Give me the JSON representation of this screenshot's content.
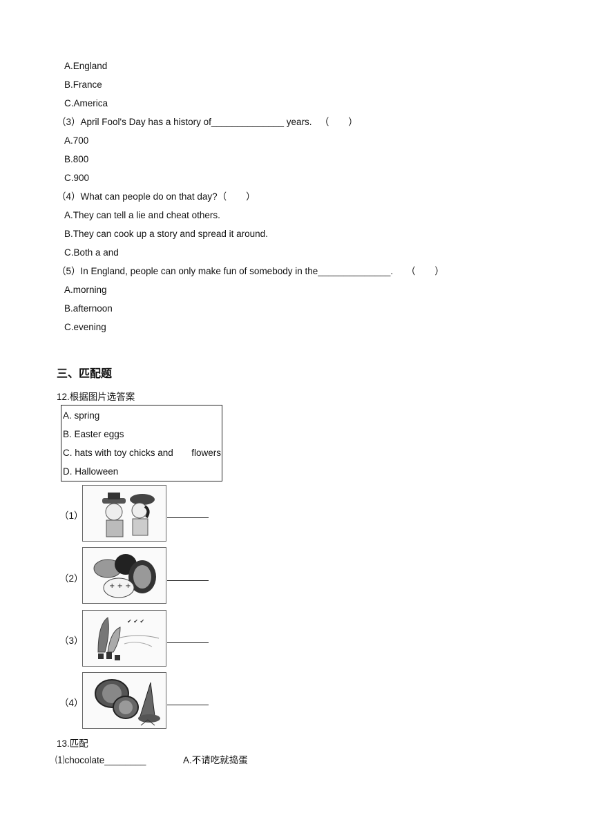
{
  "q2_options": [
    "A.England",
    "B.France",
    "C.America"
  ],
  "q3": {
    "number": "（3）",
    "text_before": "April Fool's Day has a history of",
    "blank": "______________",
    "text_after": " years.",
    "paren_open": "（",
    "paren_close": "）",
    "options": [
      "A.700",
      "B.800",
      "C.900"
    ]
  },
  "q4": {
    "number": "（4）",
    "text": "What can people do on that day?",
    "paren_open": "（",
    "paren_close": "）",
    "options": [
      "A.They can tell a lie and cheat others.",
      "B.They can cook up a story and spread it around.",
      "C.Both a and"
    ]
  },
  "q5": {
    "number": "（5）",
    "text_before": "In England, people can only make fun of somebody in the",
    "blank": "______________",
    "text_after": ".",
    "paren_open": "（",
    "paren_close": "）",
    "options": [
      "A.morning",
      "B.afternoon",
      "C.evening"
    ]
  },
  "section3": {
    "heading": "三、匹配题"
  },
  "q12": {
    "number": "12.",
    "title": "根据图片选答案",
    "choices": [
      "A. spring",
      "B. Easter eggs",
      "C. hats with toy chicks and",
      "D. Halloween"
    ],
    "choice_c_tail": "flowers",
    "pictures": [
      {
        "label": "（1）",
        "icon": "easter-hats-picture"
      },
      {
        "label": "（2）",
        "icon": "easter-eggs-picture"
      },
      {
        "label": "（3）",
        "icon": "spring-scene-picture"
      },
      {
        "label": "（4）",
        "icon": "halloween-pumpkins-picture"
      }
    ]
  },
  "q13": {
    "number": "13.",
    "title": "匹配",
    "items": [
      {
        "left": "⑴chocolate",
        "blank": "________",
        "right": "A.不请吃就捣蛋"
      }
    ]
  }
}
